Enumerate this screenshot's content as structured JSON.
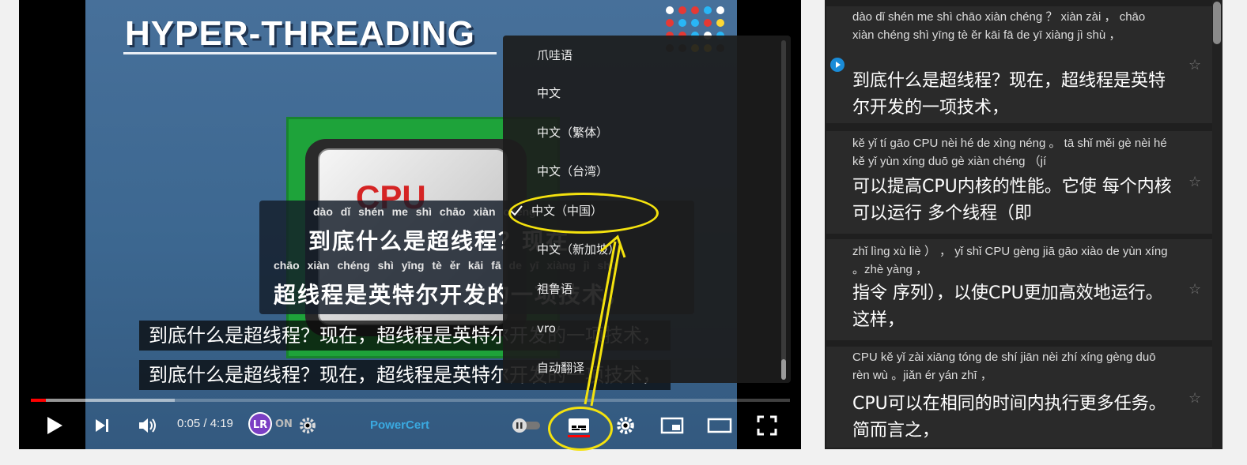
{
  "video": {
    "title_overlay": "HYPER-THREADING",
    "chip_label": "CPU",
    "burned_subtitle": {
      "pinyin_line1": "dào dǐ shén me shì chāo xiàn chéng",
      "han_line1": "到底什么是超线程？现在",
      "pinyin_line2": "chāo xiàn chéng shì yīng tè ěr kāi fā de yī xiàng jì shù",
      "han_line2": "超线程是英特尔开发的一项技术，"
    },
    "caption_lines": [
      "到底什么是超线程？现在，超线程是英特尔开发的一项技术，",
      "到底什么是超线程？现在，超线程是英特尔开发的一项技术，"
    ]
  },
  "subtitle_menu": {
    "items": [
      {
        "label": "爪哇语",
        "checked": false
      },
      {
        "label": "中文",
        "checked": false
      },
      {
        "label": "中文（繁体）",
        "checked": false
      },
      {
        "label": "中文（台湾）",
        "checked": false
      },
      {
        "label": "中文（中国）",
        "checked": true
      },
      {
        "label": "中文（新加坡）",
        "checked": false
      },
      {
        "label": "祖鲁语",
        "checked": false
      },
      {
        "label": "vro",
        "checked": false
      },
      {
        "label": "自动翻译",
        "checked": false
      }
    ]
  },
  "controls": {
    "time": "0:05 / 4:19",
    "playback_progress": 0.02,
    "buffered_progress": 0.19,
    "extension_badge": "LR",
    "extension_status": "ON",
    "channel_brand": "PowerCert",
    "icons": [
      "play-icon",
      "next-icon",
      "volume-icon",
      "gear-icon",
      "autoplay-toggle",
      "subtitles-icon",
      "settings-icon",
      "miniplayer-icon",
      "theater-icon",
      "fullscreen-icon"
    ]
  },
  "transcript_panel": {
    "cards": [
      {
        "pinyin": "dào dǐ shén me shì chāo xiàn chéng ？ xiàn zài ， chāo xiàn chéng shì yīng tè ěr kāi fā de yī xiàng jì shù ，",
        "han": "到底什么是超线程？现在，超线程是英特尔开发的一项技术，",
        "active": true
      },
      {
        "pinyin": "kě yǐ tí gāo CPU nèi hé de xìng néng 。 tā shǐ měi gè nèi hé kě yǐ yùn xíng duō gè xiàn chéng （jí",
        "han": "可以提高CPU内核的性能。它使 每个内核可以运行 多个线程（即",
        "active": false
      },
      {
        "pinyin": "zhǐ lìng xù liè ） ， yǐ shǐ CPU gèng jiā gāo xiào de yùn xíng 。zhè yàng ，",
        "han": "指令 序列），以使CPU更加高效地运行。这样，",
        "active": false
      },
      {
        "pinyin": "CPU kě yǐ zài xiāng tóng de shí jiān nèi zhí xíng gèng duō rèn wù 。jiǎn ér yán zhī ，",
        "han": "CPU可以在相同的时间内执行更多任务。简而言之，",
        "active": false
      }
    ],
    "star_glyph": "☆"
  },
  "colors": {
    "accent_red": "#ff0000",
    "annotation_yellow": "#f4e20e",
    "active_blue": "#1a8cd8",
    "brand_blue": "#3aa9e0"
  }
}
